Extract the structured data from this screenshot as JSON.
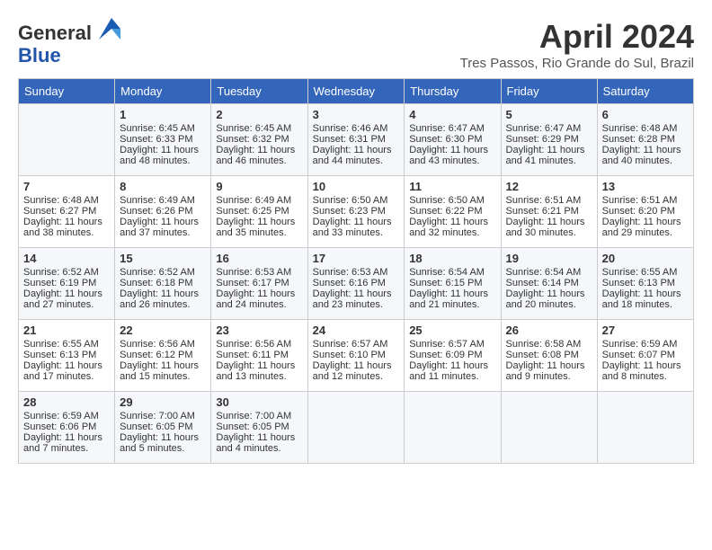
{
  "header": {
    "logo_line1": "General",
    "logo_line2": "Blue",
    "month_title": "April 2024",
    "location": "Tres Passos, Rio Grande do Sul, Brazil"
  },
  "days_of_week": [
    "Sunday",
    "Monday",
    "Tuesday",
    "Wednesday",
    "Thursday",
    "Friday",
    "Saturday"
  ],
  "weeks": [
    [
      {
        "day": "",
        "data": ""
      },
      {
        "day": "1",
        "data": "Sunrise: 6:45 AM\nSunset: 6:33 PM\nDaylight: 11 hours\nand 48 minutes."
      },
      {
        "day": "2",
        "data": "Sunrise: 6:45 AM\nSunset: 6:32 PM\nDaylight: 11 hours\nand 46 minutes."
      },
      {
        "day": "3",
        "data": "Sunrise: 6:46 AM\nSunset: 6:31 PM\nDaylight: 11 hours\nand 44 minutes."
      },
      {
        "day": "4",
        "data": "Sunrise: 6:47 AM\nSunset: 6:30 PM\nDaylight: 11 hours\nand 43 minutes."
      },
      {
        "day": "5",
        "data": "Sunrise: 6:47 AM\nSunset: 6:29 PM\nDaylight: 11 hours\nand 41 minutes."
      },
      {
        "day": "6",
        "data": "Sunrise: 6:48 AM\nSunset: 6:28 PM\nDaylight: 11 hours\nand 40 minutes."
      }
    ],
    [
      {
        "day": "7",
        "data": "Sunrise: 6:48 AM\nSunset: 6:27 PM\nDaylight: 11 hours\nand 38 minutes."
      },
      {
        "day": "8",
        "data": "Sunrise: 6:49 AM\nSunset: 6:26 PM\nDaylight: 11 hours\nand 37 minutes."
      },
      {
        "day": "9",
        "data": "Sunrise: 6:49 AM\nSunset: 6:25 PM\nDaylight: 11 hours\nand 35 minutes."
      },
      {
        "day": "10",
        "data": "Sunrise: 6:50 AM\nSunset: 6:23 PM\nDaylight: 11 hours\nand 33 minutes."
      },
      {
        "day": "11",
        "data": "Sunrise: 6:50 AM\nSunset: 6:22 PM\nDaylight: 11 hours\nand 32 minutes."
      },
      {
        "day": "12",
        "data": "Sunrise: 6:51 AM\nSunset: 6:21 PM\nDaylight: 11 hours\nand 30 minutes."
      },
      {
        "day": "13",
        "data": "Sunrise: 6:51 AM\nSunset: 6:20 PM\nDaylight: 11 hours\nand 29 minutes."
      }
    ],
    [
      {
        "day": "14",
        "data": "Sunrise: 6:52 AM\nSunset: 6:19 PM\nDaylight: 11 hours\nand 27 minutes."
      },
      {
        "day": "15",
        "data": "Sunrise: 6:52 AM\nSunset: 6:18 PM\nDaylight: 11 hours\nand 26 minutes."
      },
      {
        "day": "16",
        "data": "Sunrise: 6:53 AM\nSunset: 6:17 PM\nDaylight: 11 hours\nand 24 minutes."
      },
      {
        "day": "17",
        "data": "Sunrise: 6:53 AM\nSunset: 6:16 PM\nDaylight: 11 hours\nand 23 minutes."
      },
      {
        "day": "18",
        "data": "Sunrise: 6:54 AM\nSunset: 6:15 PM\nDaylight: 11 hours\nand 21 minutes."
      },
      {
        "day": "19",
        "data": "Sunrise: 6:54 AM\nSunset: 6:14 PM\nDaylight: 11 hours\nand 20 minutes."
      },
      {
        "day": "20",
        "data": "Sunrise: 6:55 AM\nSunset: 6:13 PM\nDaylight: 11 hours\nand 18 minutes."
      }
    ],
    [
      {
        "day": "21",
        "data": "Sunrise: 6:55 AM\nSunset: 6:13 PM\nDaylight: 11 hours\nand 17 minutes."
      },
      {
        "day": "22",
        "data": "Sunrise: 6:56 AM\nSunset: 6:12 PM\nDaylight: 11 hours\nand 15 minutes."
      },
      {
        "day": "23",
        "data": "Sunrise: 6:56 AM\nSunset: 6:11 PM\nDaylight: 11 hours\nand 13 minutes."
      },
      {
        "day": "24",
        "data": "Sunrise: 6:57 AM\nSunset: 6:10 PM\nDaylight: 11 hours\nand 12 minutes."
      },
      {
        "day": "25",
        "data": "Sunrise: 6:57 AM\nSunset: 6:09 PM\nDaylight: 11 hours\nand 11 minutes."
      },
      {
        "day": "26",
        "data": "Sunrise: 6:58 AM\nSunset: 6:08 PM\nDaylight: 11 hours\nand 9 minutes."
      },
      {
        "day": "27",
        "data": "Sunrise: 6:59 AM\nSunset: 6:07 PM\nDaylight: 11 hours\nand 8 minutes."
      }
    ],
    [
      {
        "day": "28",
        "data": "Sunrise: 6:59 AM\nSunset: 6:06 PM\nDaylight: 11 hours\nand 7 minutes."
      },
      {
        "day": "29",
        "data": "Sunrise: 7:00 AM\nSunset: 6:05 PM\nDaylight: 11 hours\nand 5 minutes."
      },
      {
        "day": "30",
        "data": "Sunrise: 7:00 AM\nSunset: 6:05 PM\nDaylight: 11 hours\nand 4 minutes."
      },
      {
        "day": "",
        "data": ""
      },
      {
        "day": "",
        "data": ""
      },
      {
        "day": "",
        "data": ""
      },
      {
        "day": "",
        "data": ""
      }
    ]
  ]
}
